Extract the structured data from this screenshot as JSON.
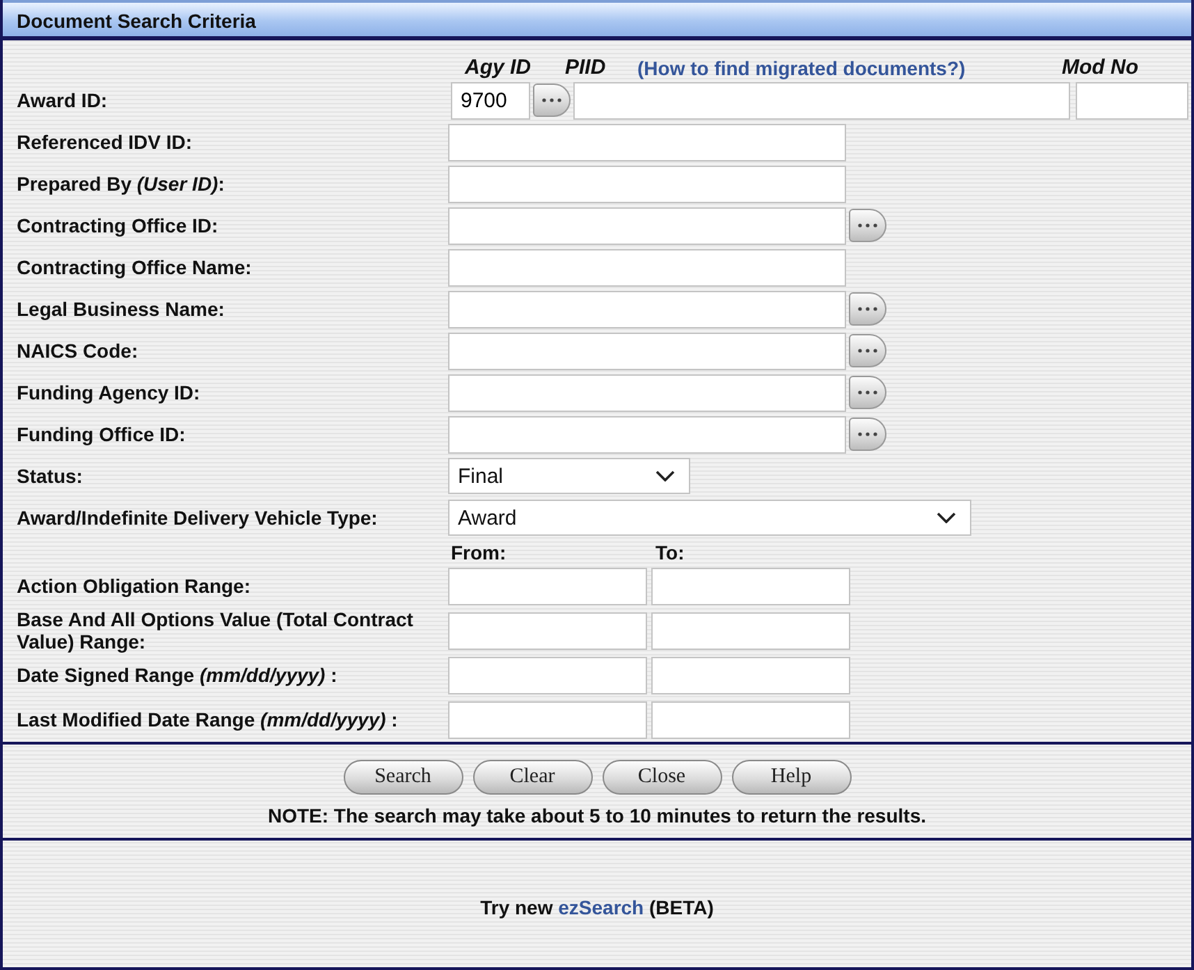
{
  "window": {
    "title": "Document Search Criteria"
  },
  "award_id": {
    "label": "Award ID:",
    "agy_id_heading": "Agy ID",
    "piid_heading": "PIID",
    "help_link": "(How to find migrated documents?)",
    "mod_no_heading": "Mod No",
    "agy_id_value": "9700"
  },
  "fields": [
    {
      "kind": "text",
      "label": "Referenced IDV ID:",
      "lookup": false
    },
    {
      "kind": "text",
      "label": "Prepared By *(User ID)*:",
      "lookup": false
    },
    {
      "kind": "text",
      "label": "Contracting Office ID:",
      "lookup": true
    },
    {
      "kind": "text",
      "label": "Contracting Office Name:",
      "lookup": false
    },
    {
      "kind": "text",
      "label": "Legal Business Name:",
      "lookup": true
    },
    {
      "kind": "text",
      "label": "NAICS Code:",
      "lookup": true
    },
    {
      "kind": "text",
      "label": "Funding Agency ID:",
      "lookup": true
    },
    {
      "kind": "text",
      "label": "Funding Office ID:",
      "lookup": true
    },
    {
      "kind": "select",
      "label": "Status:",
      "value": "Final",
      "wide": false
    },
    {
      "kind": "select",
      "label": "Award/Indefinite Delivery Vehicle Type:",
      "value": "Award",
      "wide": true
    }
  ],
  "range_headings": {
    "from": "From:",
    "to": "To:"
  },
  "ranges": [
    {
      "label": "Action Obligation Range:"
    },
    {
      "label": "Base And All Options Value (Total Contract Value) Range:"
    },
    {
      "label": "Date Signed Range *(mm/dd/yyyy)* :"
    },
    {
      "label": "Last Modified Date Range *(mm/dd/yyyy)* :"
    }
  ],
  "buttons": [
    {
      "label": "Search"
    },
    {
      "label": "Clear"
    },
    {
      "label": "Close"
    },
    {
      "label": "Help"
    }
  ],
  "note": "NOTE: The search may take about 5 to 10 minutes to return the results.",
  "footer": {
    "prefix": "Try new",
    "link": "ezSearch",
    "suffix": "(BETA)"
  }
}
